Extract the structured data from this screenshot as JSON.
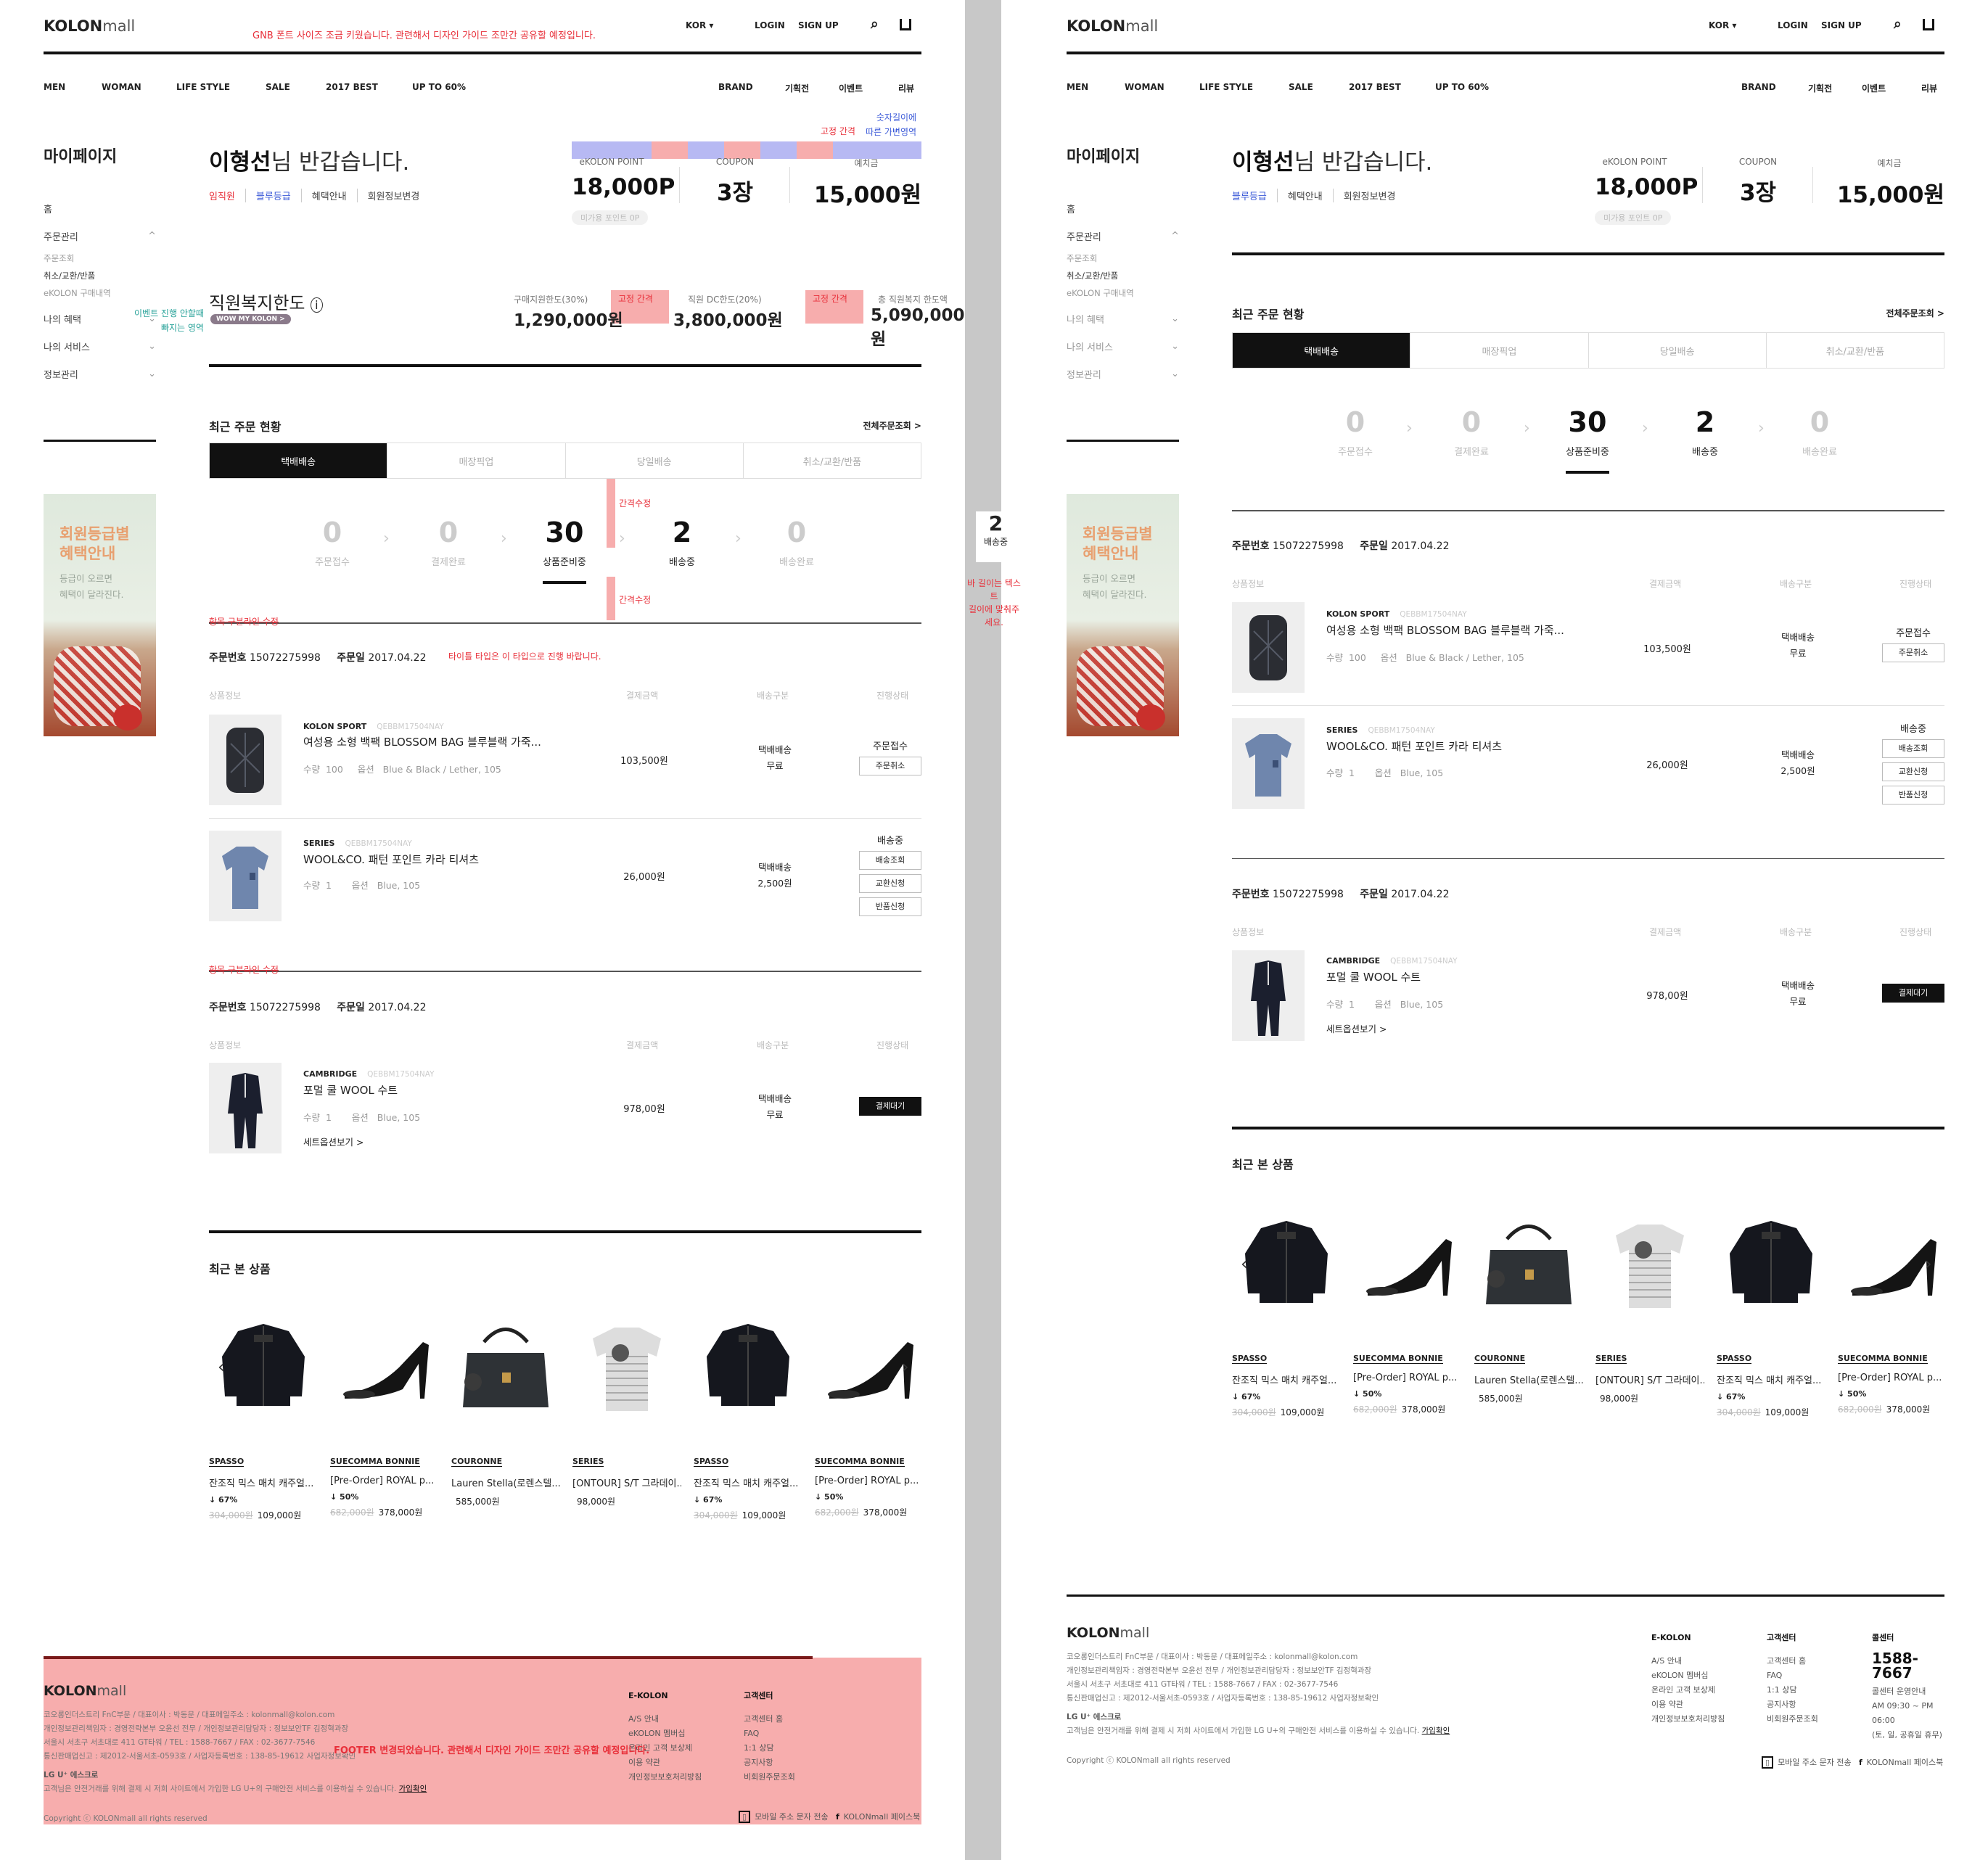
{
  "header": {
    "logo_bold": "KOLON",
    "logo_rest": "mall",
    "kor": "KOR ▾",
    "login": "LOGIN",
    "signup": "SIGN UP"
  },
  "gnb": {
    "left": [
      "MEN",
      "WOMAN",
      "LIFE STYLE",
      "SALE",
      "2017 BEST",
      "UP TO 60%"
    ],
    "right": [
      "BRAND",
      "기획전",
      "이벤트",
      "리뷰"
    ]
  },
  "sidebar": {
    "title": "마이페이지",
    "items": [
      {
        "label": "홈"
      },
      {
        "label": "주문관리",
        "arrow": "^"
      }
    ],
    "sub": [
      "주문조회",
      "취소/교환/반품",
      "eKOLON 구매내역"
    ],
    "items2": [
      {
        "label": "나의 혜택",
        "arrow": "⌄"
      },
      {
        "label": "나의 서비스",
        "arrow": "⌄"
      },
      {
        "label": "정보관리",
        "arrow": "⌄"
      }
    ],
    "banner_title": "회원등급별\n혜택안내",
    "banner_desc": "등급이 오르면\n혜택이 달라진다."
  },
  "welcome": {
    "name": "이형선",
    "rest": "님 반갑습니다.",
    "grade_staff": "임직원",
    "grade_blue": "블루등급",
    "benefit": "혜택안내",
    "edit": "회원정보변경"
  },
  "points": [
    {
      "label": "eKOLON POINT",
      "value": "18,000P",
      "pill": "미가용 포인트 0P"
    },
    {
      "label": "COUPON",
      "value": "3장"
    },
    {
      "label": "예치금",
      "value": "15,000원"
    }
  ],
  "welfare": {
    "title": "직원복지한도",
    "badge": "WOW MY KOLON >",
    "items": [
      {
        "label": "구매지원한도(30%)",
        "value": "1,290,000원"
      },
      {
        "label": "직원 DC한도(20%)",
        "value": "3,800,000원"
      },
      {
        "label": "총 직원복지 한도액",
        "value": "5,090,000원"
      }
    ]
  },
  "orders": {
    "title": "최근 주문 현황",
    "more": "전체주문조회 >",
    "tabs": [
      "택배배송",
      "매장픽업",
      "당일배송",
      "취소/교환/반품"
    ],
    "steps": [
      {
        "n": "0",
        "label": "주문접수"
      },
      {
        "n": "0",
        "label": "결제완료"
      },
      {
        "n": "30",
        "label": "상품준비중"
      },
      {
        "n": "2",
        "label": "배송중"
      },
      {
        "n": "0",
        "label": "배송완료"
      }
    ],
    "groups": [
      {
        "no_label": "주문번호",
        "no": "15072275998",
        "date_label": "주문일",
        "date": "2017.04.22",
        "cols": [
          "상품정보",
          "결제금액",
          "배송구분",
          "진행상태"
        ],
        "items": [
          {
            "brand": "KOLON SPORT",
            "code": "QEBBM17504NAY",
            "name": "여성용 소형 백팩 BLOSSOM BAG 블루블랙 가죽...",
            "qty_label": "수량",
            "qty": "100",
            "opt_label": "옵션",
            "opt": "Blue & Black / Lether, 105",
            "amount": "103,500원",
            "ship1": "택배배송",
            "ship2": "무료",
            "status": "주문접수",
            "buttons": [
              "주문취소"
            ]
          },
          {
            "brand": "SERIES",
            "code": "QEBBM17504NAY",
            "name": "WOOL&CO. 패턴 포인트 카라 티셔츠",
            "qty_label": "수량",
            "qty": "1",
            "opt_label": "옵션",
            "opt": "Blue, 105",
            "amount": "26,000원",
            "ship1": "택배배송",
            "ship2": "2,500원",
            "status": "배송중",
            "buttons": [
              "배송조회",
              "교환신청",
              "반품신청"
            ]
          }
        ]
      },
      {
        "no_label": "주문번호",
        "no": "15072275998",
        "date_label": "주문일",
        "date": "2017.04.22",
        "cols": [
          "상품정보",
          "결제금액",
          "배송구분",
          "진행상태"
        ],
        "items": [
          {
            "brand": "CAMBRIDGE",
            "code": "QEBBM17504NAY",
            "name": "포멀 쿨 WOOL 수트",
            "qty_label": "수량",
            "qty": "1",
            "opt_label": "옵션",
            "opt": "Blue, 105",
            "amount": "978,00원",
            "ship1": "택배배송",
            "ship2": "무료",
            "status": "",
            "buttons": [
              "결제대기"
            ],
            "set": "세트옵션보기 >"
          }
        ]
      }
    ]
  },
  "recent": {
    "title": "최근 본 상품",
    "items": [
      {
        "brand": "SPASSO",
        "name": "잔조직 믹스 매치 캐주얼...",
        "discount": "↓ 67%",
        "old": "304,000원",
        "price": "109,000원",
        "kind": "jacket"
      },
      {
        "brand": "SUECOMMA BONNIE",
        "name": "[Pre-Order] ROYAL p...",
        "discount": "↓ 50%",
        "old": "682,000원",
        "price": "378,000원",
        "kind": "heel"
      },
      {
        "brand": "COURONNE",
        "name": "Lauren Stella(로렌스텔...",
        "discount": "",
        "old": "",
        "price": "585,000원",
        "kind": "bag"
      },
      {
        "brand": "SERIES",
        "name": "[ONTOUR] S/T 그라데이...",
        "discount": "",
        "old": "",
        "price": "98,000원",
        "kind": "tee"
      },
      {
        "brand": "SPASSO",
        "name": "잔조직 믹스 매치 캐주얼...",
        "discount": "↓ 67%",
        "old": "304,000원",
        "price": "109,000원",
        "kind": "jacket"
      },
      {
        "brand": "SUECOMMA BONNIE",
        "name": "[Pre-Order] ROYAL p...",
        "discount": "↓ 50%",
        "old": "682,000원",
        "price": "378,000원",
        "kind": "heel"
      }
    ]
  },
  "footer": {
    "logo_bold": "KOLON",
    "logo_rest": "mall",
    "info": [
      "코오롱인더스트리 FnC부문 / 대표이사 : 박동문 / 대표메일주소 : kolonmall@kolon.com",
      "개인정보관리책임자 : 경영전략본부 오윤선 전무 / 개인정보관리담당자 : 정보보안TF 김정혁과장",
      "서울시 서초구 서초대로 411 GT타워 / TEL : 1588-7667 / FAX : 02-3677-7546",
      "통신판매업신고 : 제2012-서울서초-0593호 / 사업자등록번호 : 138-85-19612  사업자정보확인"
    ],
    "lg": "LG U⁺ 에스크로",
    "lg_desc": "고객님은 안전거래를 위해 결제 시 저희 사이트에서 가입한 LG U+의 구매안전 서비스를 이용하실 수 있습니다.",
    "lg_link": "가입확인",
    "copy": "Copyright ⓒ KOLONmall all rights reserved",
    "col1_title": "E-KOLON",
    "col1": [
      "A/S 안내",
      "eKOLON 멤버십",
      "온라인 고객 보상제",
      "이용 약관",
      "개인정보보호처리방침"
    ],
    "col2_title": "고객센터",
    "col2": [
      "고객센터 홈",
      "FAQ",
      "1:1 상담",
      "공지사항",
      "비회원주문조회"
    ],
    "col3_title": "콜센터",
    "phone": "1588-7667",
    "hours": [
      "콜센터 운영안내",
      "AM 09:30 ~ PM 06:00",
      "(토, 일, 공휴일 휴무)"
    ],
    "mobile": "모바일 주소 문자 전송",
    "facebook": "KOLONmall 페이스북"
  },
  "notes": {
    "gnb": "GNB 폰트 사이즈 조금 키웠습니다. 관련해서 디자인 가이드 조만간 공유할 예정입니다.",
    "fixed_gap": "고정 간격",
    "variable": "숫자길이에\n따른 가변영역",
    "event": "이벤트 진행 안할때\n빠지는 영역",
    "gap_edit": "간격수정",
    "line_edit": "항목 구분라인 수정",
    "title_type": "타이틀 타입은 이 타입으로 진행 바랍니다.",
    "footer": "FOOTER 변경되었습니다. 관련해서 디자인 가이드 조만간 공유할 예정입니다.",
    "mid_num": "2",
    "mid_label": "배송중",
    "mid_note": "바 길이는 텍스트\n길이에 맞춰주세요."
  }
}
